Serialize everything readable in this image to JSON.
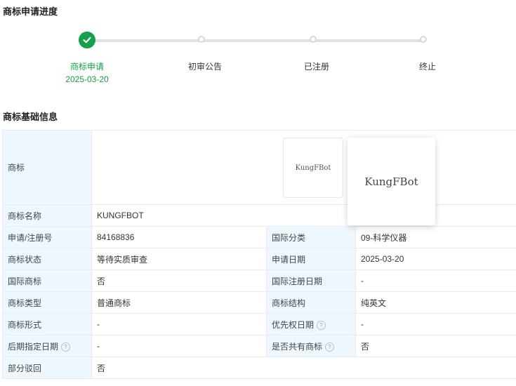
{
  "progress": {
    "title": "商标申请进度",
    "steps": [
      {
        "label": "商标申请",
        "date": "2025-03-20"
      },
      {
        "label": "初审公告"
      },
      {
        "label": "已注册"
      },
      {
        "label": "终止"
      }
    ]
  },
  "basic": {
    "title": "商标基础信息",
    "logo_label": "商标",
    "logo_text": "KungFBot",
    "name_label": "商标名称",
    "name_value": "KUNGFBOT",
    "rows": [
      {
        "l1": "申请/注册号",
        "v1": "84168836",
        "l2": "国际分类",
        "v2": "09-科学仪器"
      },
      {
        "l1": "商标状态",
        "v1": "等待实质审查",
        "l2": "申请日期",
        "v2": "2025-03-20"
      },
      {
        "l1": "国际商标",
        "v1": "否",
        "l2": "国际注册日期",
        "v2": "-"
      },
      {
        "l1": "商标类型",
        "v1": "普通商标",
        "l2": "商标结构",
        "v2": "纯英文"
      },
      {
        "l1": "商标形式",
        "v1": "-",
        "l2": "优先权日期",
        "v2": "-"
      },
      {
        "l1": "后期指定日期",
        "v1": "-",
        "l2": "是否共有商标",
        "v2": "否"
      }
    ],
    "last_label": "部分驳回",
    "last_value": "否",
    "help_glyph": "?"
  },
  "colors": {
    "accent_green": "#15a04a",
    "label_bg": "#eef6fe"
  },
  "icons": {
    "done_step": "check-icon",
    "help": "question-circle-icon"
  }
}
